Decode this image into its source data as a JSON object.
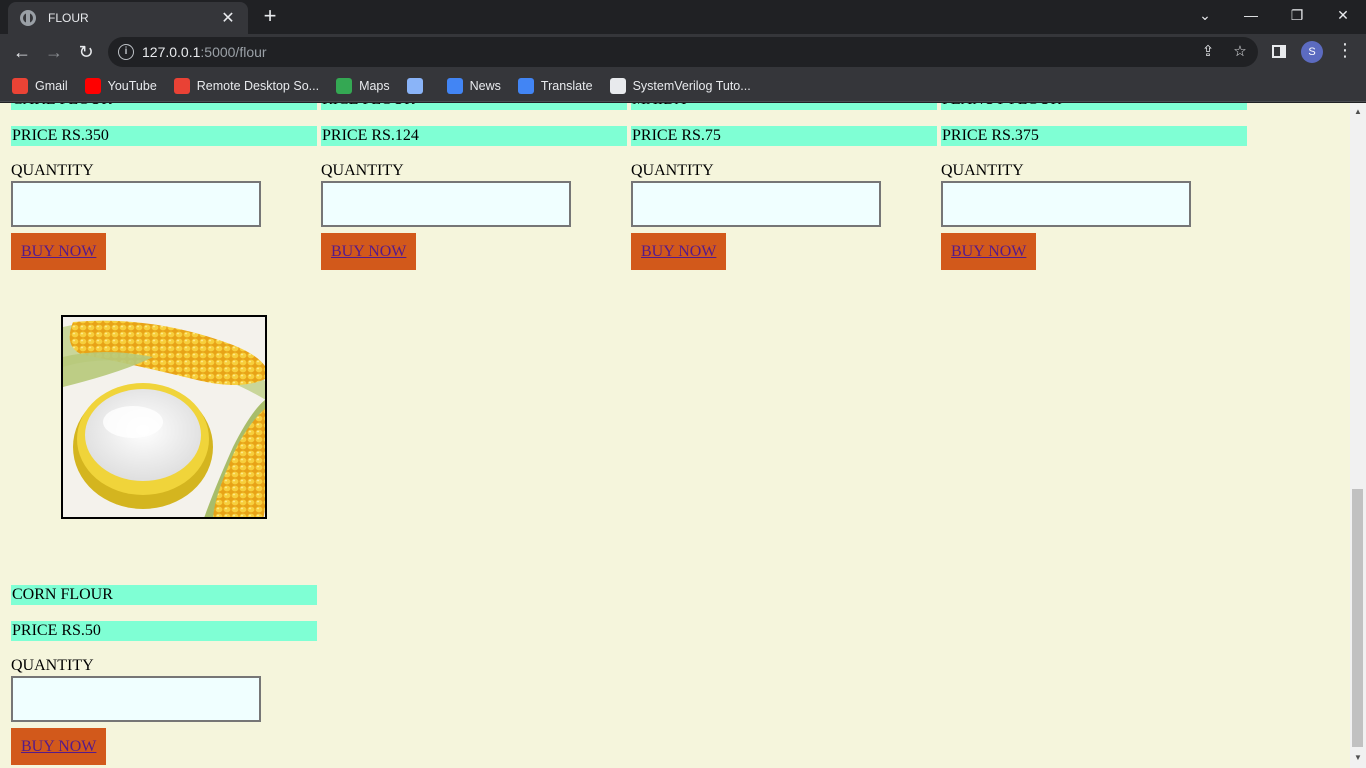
{
  "browser": {
    "tab_title": "FLOUR",
    "url_host": "127.0.0.1",
    "url_path": ":5000/flour",
    "profile_initial": "S",
    "bookmarks": [
      {
        "label": "Gmail",
        "icon": "gmail-icon",
        "color": "#ea4335"
      },
      {
        "label": "YouTube",
        "icon": "youtube-icon",
        "color": "#ff0000"
      },
      {
        "label": "Remote Desktop So...",
        "icon": "remote-desktop-icon",
        "color": "#e94235"
      },
      {
        "label": "Maps",
        "icon": "maps-icon",
        "color": "#34a853"
      },
      {
        "label": "",
        "icon": "bookmark-app-icon",
        "color": "#8ab4f8"
      },
      {
        "label": "News",
        "icon": "news-icon",
        "color": "#4285f4"
      },
      {
        "label": "Translate",
        "icon": "translate-icon",
        "color": "#4285f4"
      },
      {
        "label": "SystemVerilog Tuto...",
        "icon": "chip-icon",
        "color": "#e8eaed"
      }
    ]
  },
  "products": [
    {
      "name": "CAKE FLOUR",
      "price": "PRICE RS.350",
      "quantity_label": "QUANTITY",
      "buy_label": "BUY NOW"
    },
    {
      "name": "RICE FLOUR",
      "price": "PRICE RS.124",
      "quantity_label": "QUANTITY",
      "buy_label": "BUY NOW"
    },
    {
      "name": "MAIDA",
      "price": "PRICE RS.75",
      "quantity_label": "QUANTITY",
      "buy_label": "BUY NOW"
    },
    {
      "name": "PEANUT FLOUR",
      "price": "PRICE RS.375",
      "quantity_label": "QUANTITY",
      "buy_label": "BUY NOW"
    },
    {
      "name": "CORN FLOUR",
      "price": "PRICE RS.50",
      "quantity_label": "QUANTITY",
      "buy_label": "BUY NOW"
    }
  ],
  "colors": {
    "page_bg": "#f5f5dc",
    "label_bg": "#7fffd4",
    "button_bg": "#d2591b",
    "input_bg": "#f0ffff"
  }
}
